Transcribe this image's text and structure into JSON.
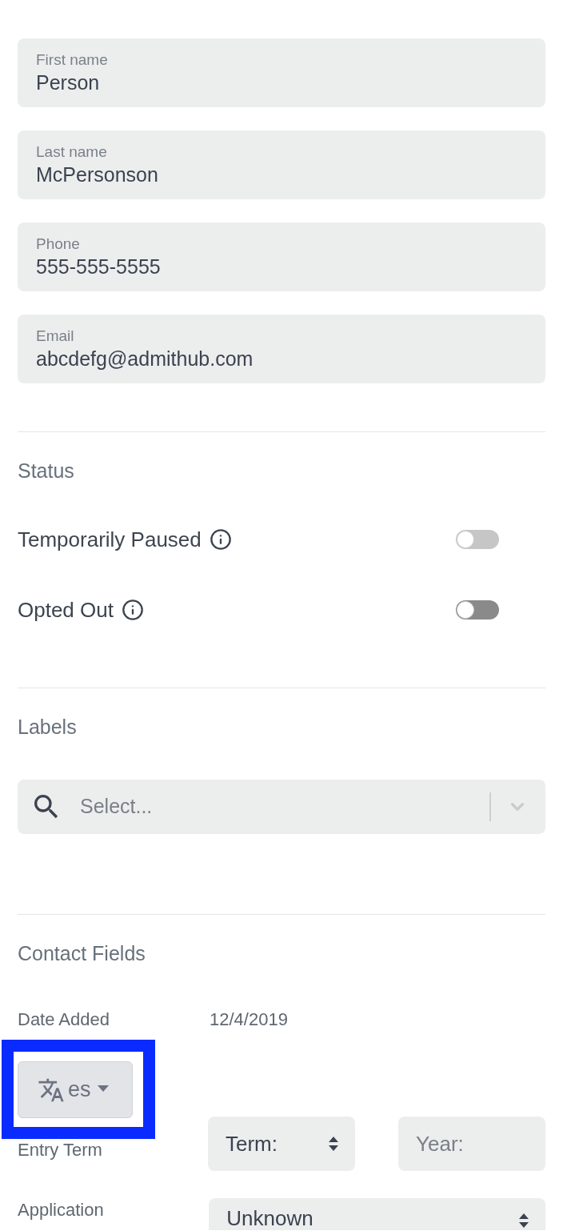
{
  "fields": [
    {
      "label": "First name",
      "value": "Person"
    },
    {
      "label": "Last name",
      "value": "McPersonson"
    },
    {
      "label": "Phone",
      "value": "555-555-5555"
    },
    {
      "label": "Email",
      "value": "abcdefg@admithub.com"
    }
  ],
  "status": {
    "heading": "Status",
    "toggles": [
      {
        "label": "Temporarily Paused",
        "on": false,
        "disabled": true
      },
      {
        "label": "Opted Out",
        "on": false,
        "disabled": false
      }
    ]
  },
  "labels": {
    "heading": "Labels",
    "select": {
      "placeholder": "Select..."
    }
  },
  "contact_fields": {
    "heading": "Contact Fields",
    "language_button": {
      "label": "es",
      "highlighted": true
    },
    "rows": [
      {
        "kind": "text",
        "label": "Date Added",
        "value": "12/4/2019"
      },
      {
        "kind": "term_year",
        "label": "Entry Term",
        "term": {
          "value": "Term:"
        },
        "year": {
          "placeholder": "Year:"
        }
      },
      {
        "kind": "select",
        "label": "Application",
        "value": "Unknown"
      }
    ]
  }
}
